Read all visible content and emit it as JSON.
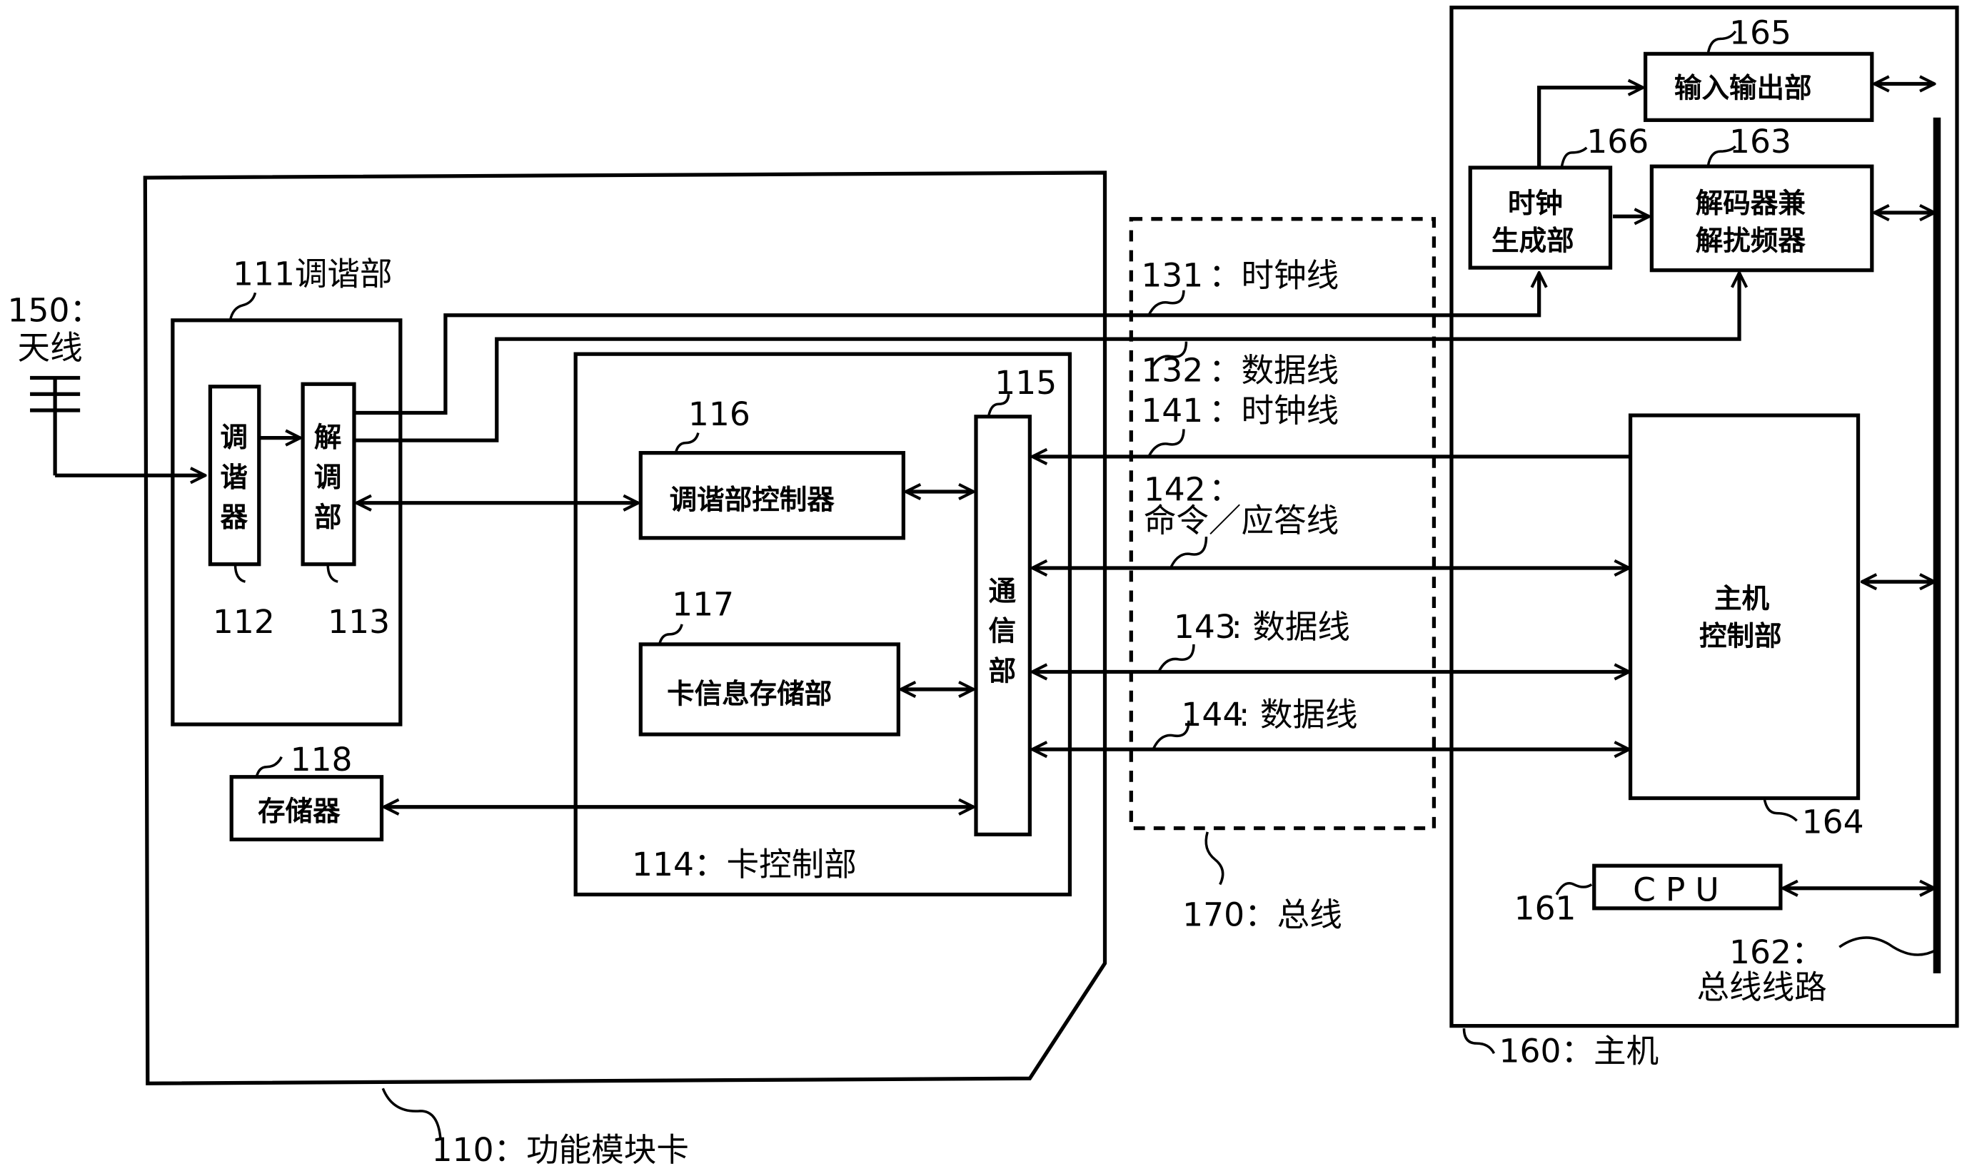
{
  "diagram": {
    "antenna": {
      "num": "150：",
      "label": "天线"
    },
    "card": {
      "label": "110：功能模块卡"
    },
    "tuner_section": {
      "label": "111调谐部"
    },
    "tuner": {
      "chars": [
        "调",
        "谐",
        "器"
      ],
      "ref": "112"
    },
    "demod": {
      "chars": [
        "解",
        "调",
        "部"
      ],
      "ref": "113"
    },
    "card_ctrl": {
      "label": "114：卡控制部"
    },
    "comm": {
      "chars": [
        "通",
        "信",
        "部"
      ],
      "ref": "115"
    },
    "tuner_ctrl": {
      "label": "调谐部控制器",
      "ref": "116"
    },
    "card_info": {
      "label": "卡信息存储部",
      "ref": "117"
    },
    "memory": {
      "label": "存储器",
      "ref": "118"
    },
    "bus": {
      "label": "170：总线",
      "lines": [
        {
          "num": "131",
          "label": "：时钟线"
        },
        {
          "num": "132",
          "label": "：数据线"
        },
        {
          "num": "141",
          "label": "：时钟线"
        },
        {
          "num": "142",
          "label": "：",
          "label2": "命令／应答线"
        },
        {
          "num": "143",
          "label": ": 数据线"
        },
        {
          "num": "144",
          "label": ": 数据线"
        }
      ]
    },
    "host": {
      "label": "160：主机"
    },
    "io": {
      "label": "输入输出部",
      "ref": "165"
    },
    "clock_gen": {
      "line1": "时钟",
      "line2": "生成部",
      "ref": "166"
    },
    "decoder": {
      "line1": "解码器兼",
      "line2": "解扰频器",
      "ref": "163"
    },
    "host_ctrl": {
      "line1": "主机",
      "line2": "控制部",
      "ref": "164"
    },
    "cpu": {
      "label": "CPU",
      "ref": "161"
    },
    "bus_line": {
      "num": "162：",
      "label": "总线线路"
    }
  }
}
